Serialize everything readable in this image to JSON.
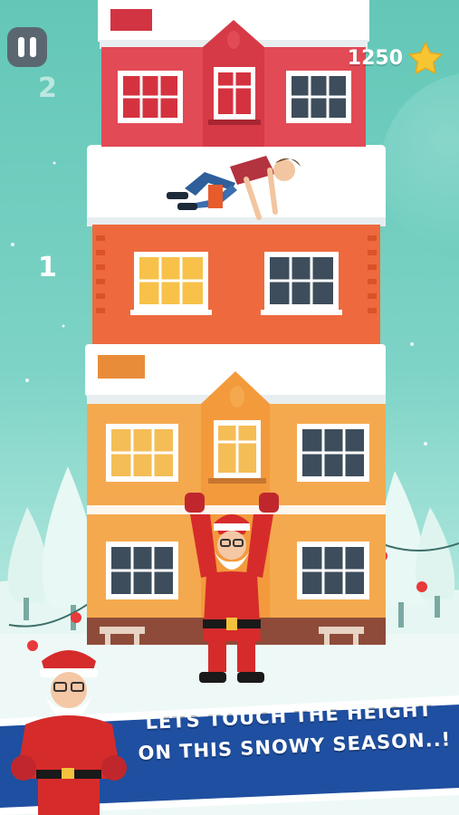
{
  "hud": {
    "score": "1250",
    "floor_numbers": [
      "2",
      "1"
    ]
  },
  "banner": {
    "line1": "LETS TOUCH THE HEIGHT",
    "line2": "ON THIS SNOWY SEASON..!"
  },
  "icons": {
    "pause": "pause-icon",
    "star": "star-icon",
    "santa": "santa-character"
  },
  "colors": {
    "sky": "#6fcdbf",
    "red_house": "#e24a56",
    "orange_floor": "#ee6a3e",
    "yellow_house": "#f5a94f",
    "santa_red": "#d62b2b",
    "banner_blue": "#1f4fa0",
    "star": "#f7c531"
  }
}
